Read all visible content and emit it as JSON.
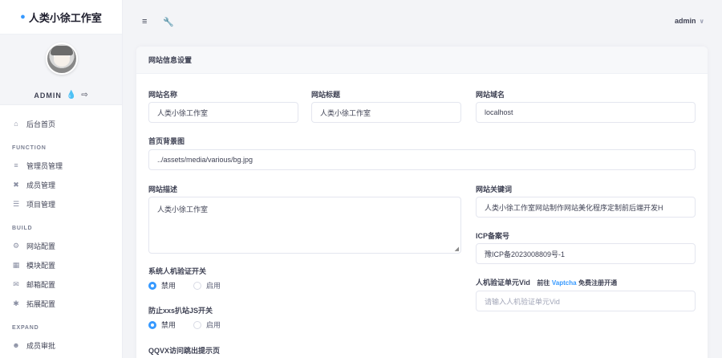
{
  "brand": {
    "title": "人类小徐工作室",
    "icon": "flame-icon"
  },
  "profile": {
    "name": "ADMIN"
  },
  "nav": {
    "dashboard": "后台首页",
    "section_function": "FUNCTION",
    "admin_manage": "管理员管理",
    "member_manage": "成员管理",
    "project_manage": "项目管理",
    "section_build": "BUILD",
    "site_config": "网站配置",
    "module_config": "模块配置",
    "mail_config": "邮箱配置",
    "extend_config": "拓展配置",
    "section_expand": "EXPAND",
    "member_review": "成员审批"
  },
  "topbar": {
    "user": "admin"
  },
  "card": {
    "title": "网站信息设置"
  },
  "form": {
    "site_name_label": "网站名称",
    "site_name_value": "人类小徐工作室",
    "site_title_label": "网站标题",
    "site_title_value": "人类小徐工作室",
    "domain_label": "网站域名",
    "domain_value": "localhost",
    "bg_label": "首页背景图",
    "bg_value": "../assets/media/various/bg.jpg",
    "desc_label": "网站描述",
    "desc_value": "人类小徐工作室",
    "keywords_label": "网站关键词",
    "keywords_value": "人类小徐工作室网站制作网站美化程序定制前后端开发H",
    "icp_label": "ICP备案号",
    "icp_value": "豫ICP备2023008809号-1",
    "captcha_switch_label": "系统人机验证开关",
    "opt_disabled": "禁用",
    "opt_enabled": "启用",
    "xss_label": "防止xxs扒站JS开关",
    "vid_label": "人机验证单元Vid",
    "vid_hint_prefix": "前往",
    "vid_hint_link": "Vaptcha",
    "vid_hint_suffix": "免费注册开通",
    "vid_placeholder": "请输入人机验证单元Vid",
    "qqvx_label": "QQVX访问跳出提示页"
  },
  "colors": {
    "accent": "#3699ff"
  }
}
